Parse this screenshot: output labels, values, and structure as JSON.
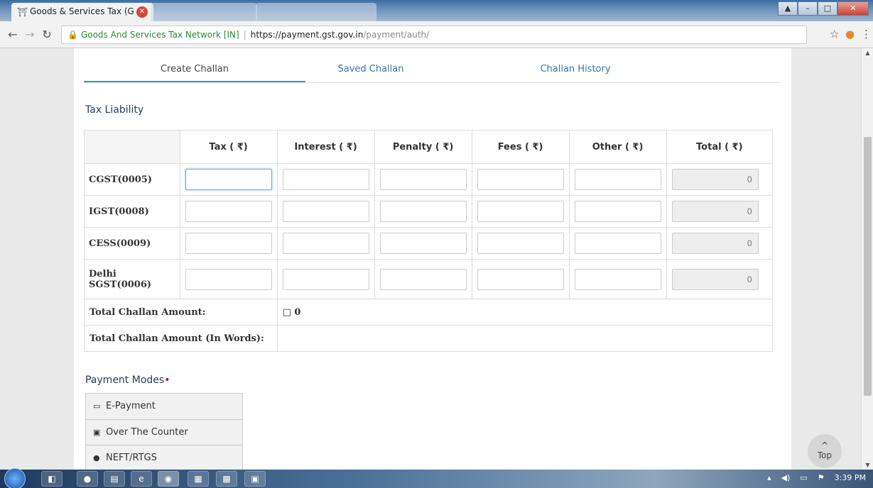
{
  "browser": {
    "active_tab_title": "Goods & Services Tax (G",
    "other_tabs": [
      "",
      ""
    ],
    "security_label": "Goods And Services Tax Network [IN]",
    "url_host": "https://payment.gst.gov.in",
    "url_path": "/payment/auth/"
  },
  "tabs": [
    {
      "label": "Create Challan",
      "active": true
    },
    {
      "label": "Saved Challan",
      "active": false
    },
    {
      "label": "Challan History",
      "active": false
    }
  ],
  "tax_liability": {
    "title": "Tax Liability",
    "columns": [
      "",
      "Tax ( ₹)",
      "Interest ( ₹)",
      "Penalty ( ₹)",
      "Fees ( ₹)",
      "Other ( ₹)",
      "Total ( ₹)"
    ],
    "rows": [
      {
        "label": "CGST(0005)",
        "total": "0"
      },
      {
        "label": "IGST(0008)",
        "total": "0"
      },
      {
        "label": "CESS(0009)",
        "total": "0"
      },
      {
        "label": "Delhi SGST(0006)",
        "total": "0"
      }
    ],
    "total_amount_label": "Total Challan Amount:",
    "total_amount_value": "□ 0",
    "total_words_label": "Total Challan Amount (In Words):",
    "total_words_value": ""
  },
  "payment_modes": {
    "title": "Payment Modes",
    "required_mark": "•",
    "items": [
      {
        "label": "E-Payment",
        "icon": "credit-card-icon"
      },
      {
        "label": "Over The Counter",
        "icon": "cash-icon"
      },
      {
        "label": "NEFT/RTGS",
        "icon": "globe-icon"
      }
    ]
  },
  "top_button": {
    "label": "Top"
  },
  "taskbar": {
    "clock": "3:39 PM"
  }
}
